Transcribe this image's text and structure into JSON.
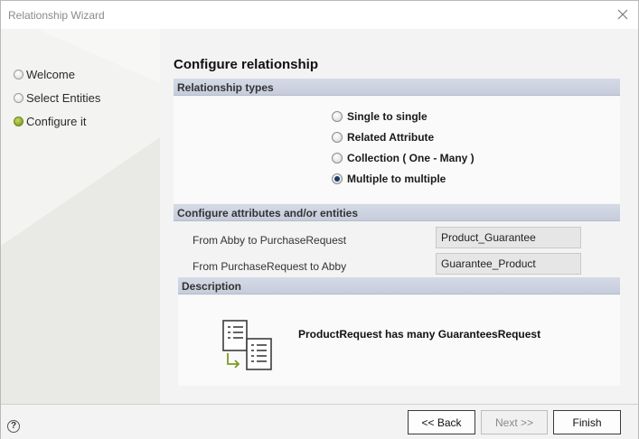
{
  "window": {
    "title": "Relationship Wizard"
  },
  "steps": [
    {
      "label": "Welcome",
      "active": false
    },
    {
      "label": "Select Entities",
      "active": false
    },
    {
      "label": "Configure it",
      "active": true
    }
  ],
  "main": {
    "heading": "Configure relationship",
    "relationship_types": {
      "header": "Relationship types",
      "options": [
        {
          "label": "Single to single",
          "checked": false
        },
        {
          "label": "Related Attribute",
          "checked": false
        },
        {
          "label": "Collection ( One - Many )",
          "checked": false
        },
        {
          "label": "Multiple to multiple",
          "checked": true
        }
      ]
    },
    "attributes": {
      "header": "Configure attributes and/or entities",
      "rows": [
        {
          "label": "From Abby to PurchaseRequest",
          "value": "Product_Guarantee"
        },
        {
          "label": "From PurchaseRequest to Abby",
          "value": "Guarantee_Product"
        }
      ]
    },
    "description": {
      "header": "Description",
      "text": "ProductRequest has many GuaranteesRequest",
      "icon": "documents-relation-icon"
    }
  },
  "footer": {
    "help_label": "?",
    "back_label": "<< Back",
    "next_label": "Next >>",
    "finish_label": "Finish"
  },
  "colors": {
    "accent_green": "#7d9a22",
    "section_header": "#c6ccdb"
  }
}
